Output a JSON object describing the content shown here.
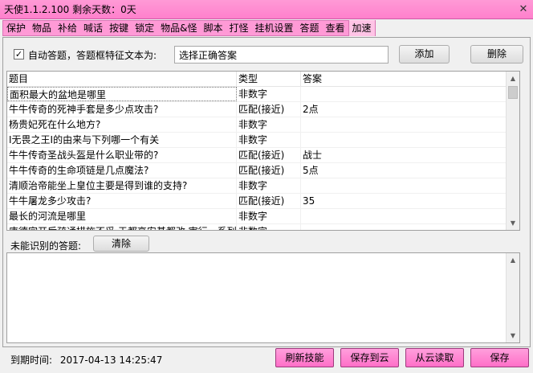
{
  "window": {
    "title": "天使1.1.2.100 剩余天数：0天",
    "close_glyph": "✕"
  },
  "tabs": [
    {
      "label": "保护"
    },
    {
      "label": "物品"
    },
    {
      "label": "补给"
    },
    {
      "label": "喊话"
    },
    {
      "label": "按键"
    },
    {
      "label": "锁定"
    },
    {
      "label": "物品&怪"
    },
    {
      "label": "脚本"
    },
    {
      "label": "打怪"
    },
    {
      "label": "挂机设置"
    },
    {
      "label": "答题"
    },
    {
      "label": "查看"
    },
    {
      "label": "加速"
    }
  ],
  "active_tab": "加速",
  "auto_answer": {
    "checked": true,
    "check_glyph": "✓",
    "label": "自动答题，答题框特征文本为:",
    "feature_text": "选择正确答案",
    "add_label": "添加",
    "delete_label": "删除"
  },
  "table": {
    "headers": [
      "题目",
      "类型",
      "答案"
    ],
    "rows": [
      {
        "question": "面积最大的盆地是哪里",
        "type": "非数字",
        "answer": ""
      },
      {
        "question": "牛牛传奇的死神手套是多少点攻击?",
        "type": "匹配(接近)",
        "answer": "2点"
      },
      {
        "question": "杨贵妃死在什么地方?",
        "type": "非数字",
        "answer": ""
      },
      {
        "question": "I无畏之王I的由来与下列哪一个有关",
        "type": "非数字",
        "answer": ""
      },
      {
        "question": "牛牛传奇圣战头盔是什么职业带的?",
        "type": "匹配(接近)",
        "answer": "战士"
      },
      {
        "question": "牛牛传奇的生命项链是几点魔法?",
        "type": "匹配(接近)",
        "answer": "5点"
      },
      {
        "question": "清顺治帝能坐上皇位主要是得到谁的支持?",
        "type": "非数字",
        "answer": ""
      },
      {
        "question": "牛牛屠龙多少攻击?",
        "type": "匹配(接近)",
        "answer": "35"
      },
      {
        "question": "最长的河流是哪里",
        "type": "非数字",
        "answer": ""
      },
      {
        "question": "唐德宗开后疏通措施不妥,于都高安基都改,宰行一系列...",
        "type": "非数字",
        "answer": ""
      }
    ]
  },
  "unrecognized": {
    "label": "未能识别的答题:",
    "clear_label": "清除",
    "content": ""
  },
  "footer": {
    "expire_label": "到期时间:",
    "expire_value": "2017-04-13 14:25:47",
    "refresh_skills_label": "刷新技能",
    "save_cloud_label": "保存到云",
    "load_cloud_label": "从云读取",
    "save_label": "保存"
  },
  "colors": {
    "pink_accent": "#ff80cc",
    "pink_button": "#ff6fc8"
  }
}
